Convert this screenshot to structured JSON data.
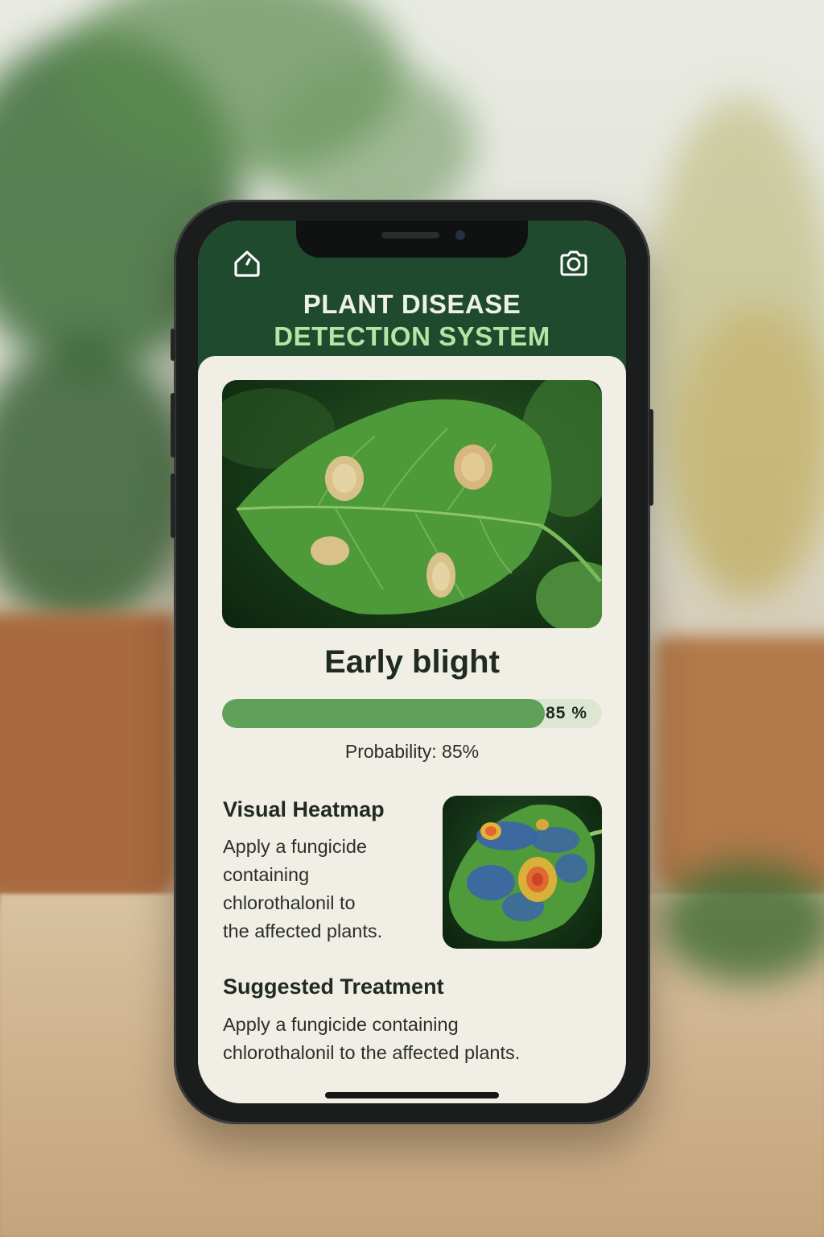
{
  "header": {
    "title_line1": "PLANT DISEASE",
    "title_line2": "DETECTION SYSTEM",
    "left_icon": "home-icon",
    "right_icon": "camera-icon"
  },
  "result": {
    "disease_name": "Early blight",
    "probability_value": 85,
    "probability_badge": "85 %",
    "probability_label": "Probability: 85%"
  },
  "heatmap_section": {
    "title": "Visual Heatmap",
    "lines": [
      "Apply a fungicide",
      "containing",
      "chlorothalonil to",
      "the affected plants."
    ]
  },
  "treatment_section": {
    "title": "Suggested Treatment",
    "lines": [
      "Apply a fungicide containing",
      "chlorothalonil to the affected plants."
    ]
  },
  "colors": {
    "header_bg": "#1f4a2d",
    "title_accent": "#b9e3a4",
    "progress_fill": "#5fa05a",
    "progress_track": "#dde6d3",
    "card_bg": "#f1efe5"
  }
}
